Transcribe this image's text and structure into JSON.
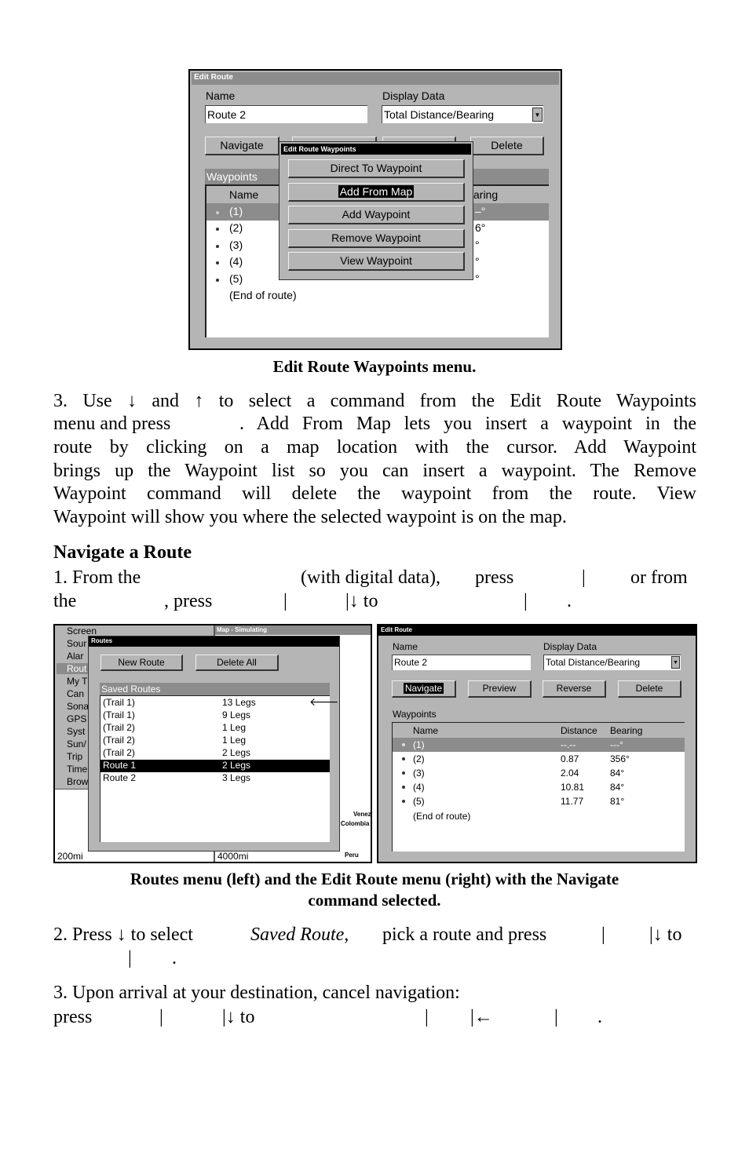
{
  "top_screen": {
    "title": "Edit Route",
    "name_label": "Name",
    "name_value": "Route 2",
    "display_label": "Display Data",
    "display_value": "Total Distance/Bearing",
    "navigate": "Navigate",
    "delete": "Delete",
    "waypoints_label": "Waypoints",
    "col_name": "Name",
    "col_bearing_fragment": "aring",
    "rows": [
      {
        "name": "(1)",
        "frag": "–°"
      },
      {
        "name": "(2)",
        "frag": "6°"
      },
      {
        "name": "(3)",
        "frag": "°"
      },
      {
        "name": "(4)",
        "frag": "°"
      },
      {
        "name": "(5)",
        "frag": "°"
      }
    ],
    "end": "(End of route)",
    "popup": {
      "title": "Edit Route Waypoints",
      "items": [
        "Direct To Waypoint",
        "Add From Map",
        "Add Waypoint",
        "Remove Waypoint",
        "View Waypoint"
      ],
      "selected": "Add From Map"
    }
  },
  "caption1": "Edit Route Waypoints menu.",
  "para3": {
    "l1": "3. Use ↓ and ↑ to select a command from the Edit Route Waypoints",
    "l2a": "menu and press",
    "l2b": ". Add From Map lets you insert a waypoint in the",
    "l3": "route by clicking on a map location with the cursor. Add Waypoint",
    "l4": "brings up the Waypoint list so you can insert a waypoint. The Remove",
    "l5": "Waypoint command will delete the waypoint from the route. View",
    "l6": "Waypoint will show you where the selected waypoint is on the map."
  },
  "heading": "Navigate a Route",
  "step1": {
    "a": "1. From the",
    "b": "(with digital data),",
    "c": "press",
    "d": "|",
    "e": "or from",
    "f": "the",
    ",g": "",
    "g": ", press",
    "h": "|",
    "i": "|↓ to",
    "j": "|",
    "k": "."
  },
  "left_screen": {
    "menu": [
      "Screen",
      "Sour",
      "Alar",
      "Rout",
      "My T",
      "Can",
      "Sona",
      "GPS",
      "Syst",
      "Sun/",
      "Trip",
      "Time",
      "Brow"
    ],
    "menu_selected": "Rout",
    "map_title": "Map - Simulating",
    "scale_left": "200mi",
    "scale_right": "4000mi",
    "places": [
      "Venez",
      "Colombia",
      "Peru"
    ],
    "dialog": {
      "title": "Routes",
      "new_route": "New Route",
      "delete_all": "Delete All",
      "saved_label": "Saved Routes",
      "routes": [
        {
          "name": "(Trail 1)",
          "legs": "13 Legs"
        },
        {
          "name": "(Trail 1)",
          "legs": "9 Legs"
        },
        {
          "name": "(Trail 2)",
          "legs": "1 Leg"
        },
        {
          "name": "(Trail 2)",
          "legs": "1 Leg"
        },
        {
          "name": "(Trail 2)",
          "legs": "2 Legs"
        },
        {
          "name": "Route 1",
          "legs": "2 Legs"
        },
        {
          "name": "Route 2",
          "legs": "3 Legs"
        }
      ],
      "selected": "Route 1"
    }
  },
  "right_screen": {
    "title": "Edit Route",
    "name_label": "Name",
    "name_value": "Route 2",
    "display_label": "Display Data",
    "display_value": "Total Distance/Bearing",
    "buttons": [
      "Navigate",
      "Preview",
      "Reverse",
      "Delete"
    ],
    "selected_button": "Navigate",
    "waypoints_label": "Waypoints",
    "cols": [
      "Name",
      "Distance",
      "Bearing"
    ],
    "rows": [
      {
        "name": "(1)",
        "dist": "--.--",
        "bearing": "---°"
      },
      {
        "name": "(2)",
        "dist": "0.87",
        "bearing": "356°"
      },
      {
        "name": "(3)",
        "dist": "2.04",
        "bearing": "84°"
      },
      {
        "name": "(4)",
        "dist": "10.81",
        "bearing": "84°"
      },
      {
        "name": "(5)",
        "dist": "11.77",
        "bearing": "81°"
      }
    ],
    "end": "(End of route)"
  },
  "caption2": {
    "l1": "Routes menu (left) and the Edit Route menu (right) with the Navigate",
    "l2": "command selected."
  },
  "step2": {
    "l1a": "2. Press ↓ to select",
    "l1b": "Saved Route,",
    "l1c": "pick a route and press",
    "l1d": "|",
    "l1e": "|↓ to",
    "l2a": "|",
    "l2b": "."
  },
  "step3": {
    "l1": "3. Upon arrival at your destination, cancel navigation:",
    "a": "press",
    "b": "|",
    "c": "|↓ to",
    "d": "|",
    "e": "|←",
    "f": "|",
    "g": "."
  }
}
